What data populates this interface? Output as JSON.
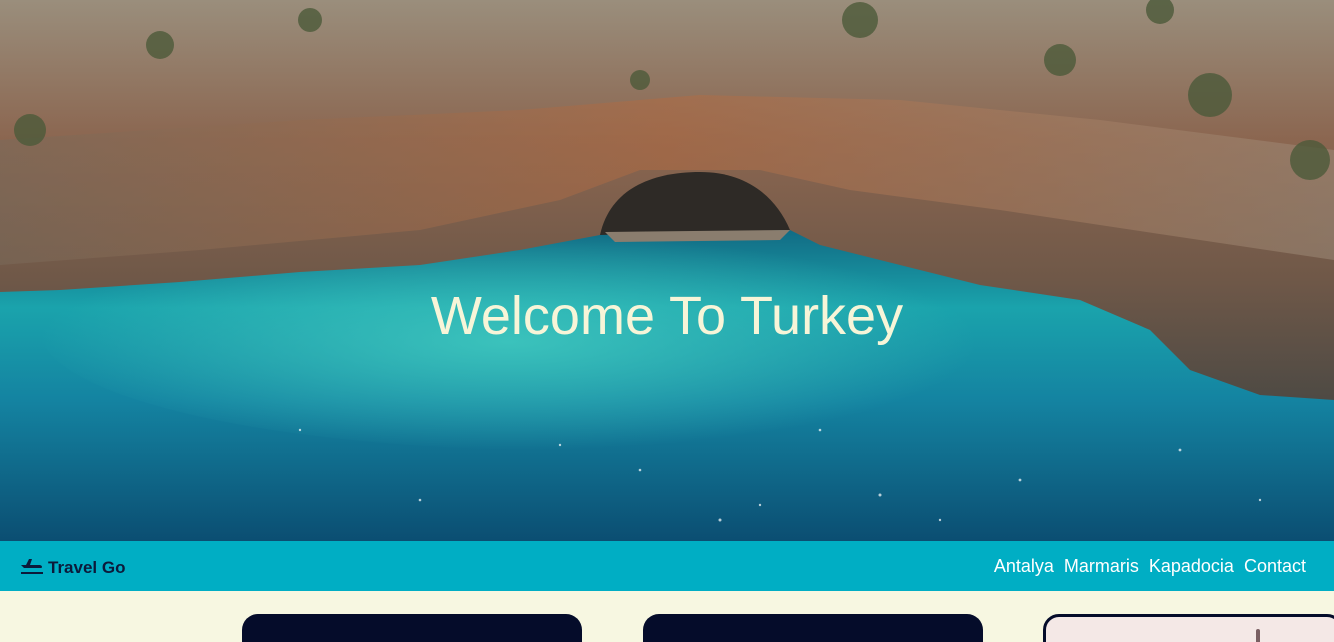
{
  "hero": {
    "title": "Welcome To Turkey",
    "title_color": "#f7f5d8"
  },
  "navbar": {
    "background": "#00aec4",
    "brand": {
      "icon": "airplane-icon",
      "name": "Travel Go"
    },
    "links": [
      {
        "label": "Antalya"
      },
      {
        "label": "Marmaris"
      },
      {
        "label": "Kapadocia"
      },
      {
        "label": "Contact"
      }
    ]
  },
  "content": {
    "background": "#f7f7e1",
    "card_color": "#050c2a"
  }
}
